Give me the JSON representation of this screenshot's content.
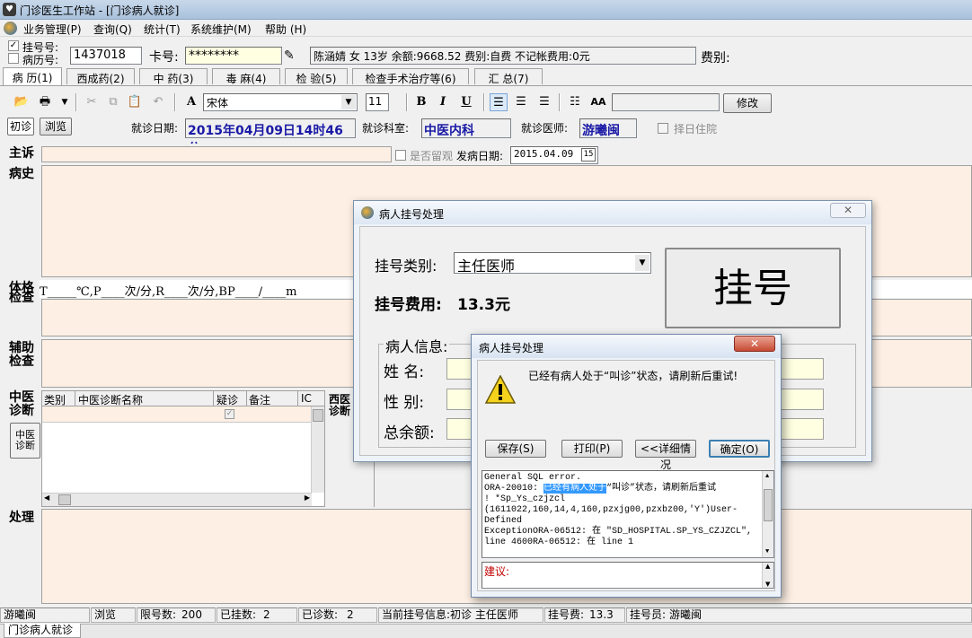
{
  "window": {
    "title": "门诊医生工作站 - [门诊病人就诊]"
  },
  "menu": [
    "业务管理(P)",
    "查询(Q)",
    "统计(T)",
    "系统维护(M)",
    "帮助 (H)"
  ],
  "patient_bar": {
    "reg_no_label": "挂号号:",
    "record_no_label": "病历号:",
    "reg_no_value": "1437018",
    "card_label": "卡号:",
    "card_value": "********",
    "info": "陈涵婧  女  13岁  余额:9668.52  费别:自费  不记帐费用:0元",
    "fee_label": "费别:",
    "reg_checked": true,
    "record_checked": false
  },
  "tabs": [
    "病  历(1)",
    "西成药(2)",
    "中  药(3)",
    "毒  麻(4)",
    "检  验(5)",
    "检查手术治疗等(6)",
    "汇  总(7)"
  ],
  "toolbar": {
    "font_name": "宋体",
    "font_size": "11",
    "modify_label": "修改",
    "bold": "B",
    "italic": "I",
    "underline": "U",
    "font_glyph": "A",
    "aa_glyph": "AA"
  },
  "visit": {
    "first_visit": "初诊",
    "browse": "浏览",
    "date_label": "就诊日期:",
    "date_value": "2015年04月09日14时46分",
    "dept_label": "就诊科室:",
    "dept_value": "中医内科",
    "doctor_label": "就诊医师:",
    "doctor_value": "游曦闽",
    "hospital_label": "择日住院"
  },
  "record": {
    "complaint": "主诉",
    "observe_label": "是否留观",
    "onset_label": "发病日期:",
    "onset_value": "2015.04.09",
    "onset_btn": "15",
    "history": "病史",
    "exam_line1": "体格",
    "exam_line2": "检查",
    "vitals": "T_____℃,P____次/分,R____次/分,BP____/____m",
    "aux_line1": "辅助",
    "aux_line2": "检查",
    "tcm_line1": "中医",
    "tcm_line2": "诊断",
    "tcm_sub1": "中医",
    "tcm_sub2": "诊断",
    "wm_line1": "西医",
    "wm_line2": "诊断",
    "treatment": "处理",
    "diag_headers": [
      "类别",
      "中医诊断名称",
      "疑诊",
      "备注",
      "IC"
    ]
  },
  "reg_dialog": {
    "title": "病人挂号处理",
    "type_label": "挂号类别:",
    "type_value": "主任医师",
    "fee_label": "挂号费用:",
    "fee_value": "13.3元",
    "register_button": "挂号",
    "patient_info_label": "病人信息:",
    "name_label": "姓    名:",
    "gender_label": "性    别:",
    "balance_label": "总余额:"
  },
  "error_dialog": {
    "title": "病人挂号处理",
    "message": "已经有病人处于“叫诊”状态，请刷新后重试!",
    "buttons": [
      "保存(S)",
      "打印(P)",
      "<<详细情况",
      "确定(O)"
    ],
    "detail_lines": [
      "General SQL error.",
      "ORA-20010: ",
      "已经有病人处于",
      "“叫诊”状态，请刷新后重试",
      "! *Sp_Ys_czjzcl",
      "(1611022,160,14,4,160,pzxjg00,pzxbz00,'Y')User-",
      "Defined",
      "ExceptionORA-06512: 在 \"SD_HOSPITAL.SP_YS_CZJZCL\",",
      "line 4600RA-06512: 在 line 1"
    ],
    "suggestion_label": "建议:"
  },
  "statusbar": {
    "user": "游曦闽",
    "mode": "浏览",
    "limit_label": "限号数:",
    "limit_value": "200",
    "registered_label": "已挂数:",
    "registered_value": "2",
    "seen_label": "已诊数:",
    "seen_value": "2",
    "current_label": "当前挂号信息:",
    "current_value": "初诊  主任医师",
    "fee_label": "挂号费:",
    "fee_value": "13.3",
    "clerk_label": "挂号员:",
    "clerk_value": "游曦闽"
  },
  "bottom_tab": "门诊病人就诊"
}
